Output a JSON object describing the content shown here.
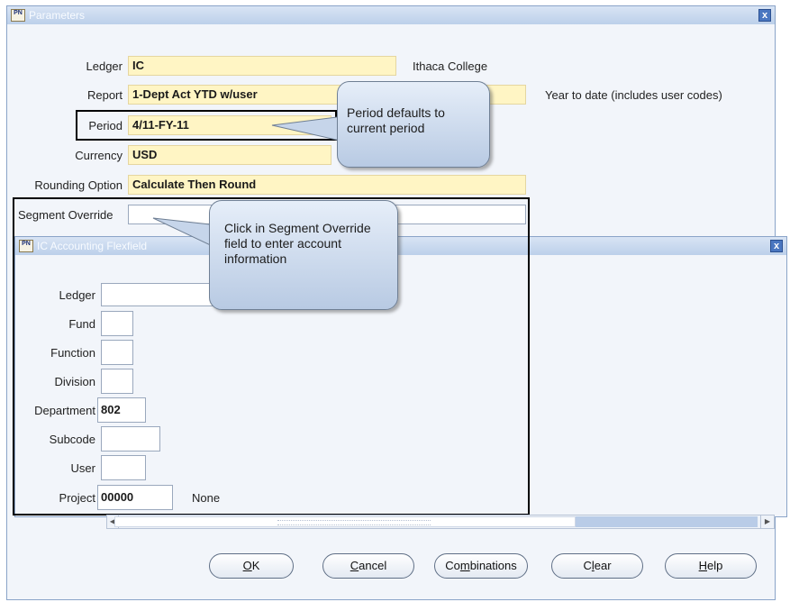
{
  "params_window": {
    "title": "Parameters",
    "fields": {
      "ledger": {
        "label": "Ledger",
        "value": "IC",
        "description": "Ithaca College"
      },
      "report": {
        "label": "Report",
        "value": "1-Dept Act YTD w/user",
        "description": "Year to date (includes user codes)"
      },
      "period": {
        "label": "Period",
        "value": "4/11-FY-11"
      },
      "currency": {
        "label": "Currency",
        "value": "USD"
      },
      "rounding": {
        "label": "Rounding Option",
        "value": "Calculate Then Round"
      },
      "segment_override": {
        "label": "Segment Override",
        "value": ""
      }
    }
  },
  "callouts": {
    "period": "Period defaults to current period",
    "segment": "Click in Segment Override field to enter account information"
  },
  "flex_window": {
    "title": "IC Accounting Flexfield",
    "fields": {
      "ledger": {
        "label": "Ledger",
        "value": ""
      },
      "fund": {
        "label": "Fund",
        "value": ""
      },
      "function": {
        "label": "Function",
        "value": ""
      },
      "division": {
        "label": "Division",
        "value": ""
      },
      "department": {
        "label": "Department",
        "value": "802"
      },
      "subcode": {
        "label": "Subcode",
        "value": ""
      },
      "user": {
        "label": "User",
        "value": ""
      },
      "project": {
        "label": "Project",
        "value": "00000",
        "description": "None"
      }
    },
    "lov_button": "..."
  },
  "buttons": {
    "ok": {
      "mnemonic": "O",
      "rest": "K"
    },
    "cancel": {
      "mnemonic": "C",
      "rest": "ancel"
    },
    "combinations": {
      "pre": "Co",
      "mnemonic": "m",
      "rest": "binations"
    },
    "clear": {
      "pre": "C",
      "mnemonic": "l",
      "rest": "ear"
    },
    "help": {
      "mnemonic": "H",
      "rest": "elp"
    }
  },
  "icons": {
    "app": "PN",
    "close": "x",
    "scroll_left": "◀",
    "scroll_right": "▶"
  },
  "colors": {
    "field_yellow": "#fff5c4",
    "title_blue": "#bcd0ea"
  }
}
